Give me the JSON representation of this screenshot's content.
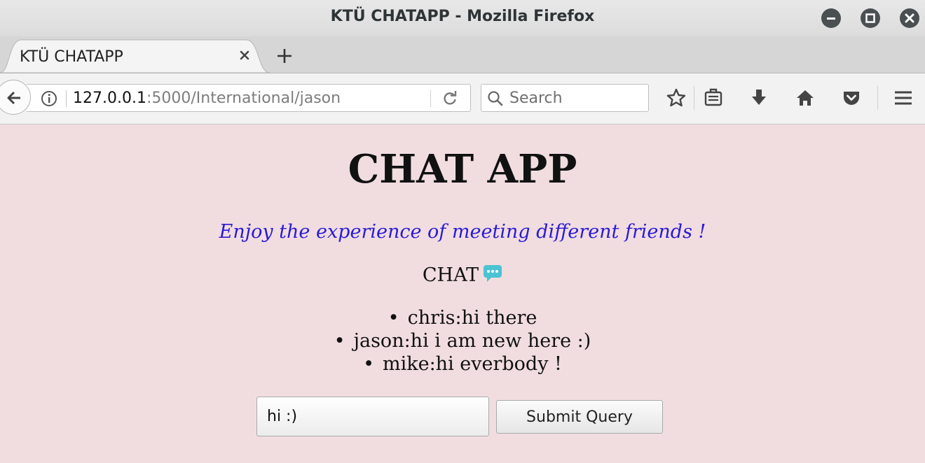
{
  "window": {
    "title": "KTÜ CHATAPP - Mozilla Firefox"
  },
  "tabs": [
    {
      "label": "KTÜ CHATAPP",
      "active": true
    }
  ],
  "navbar": {
    "url_host": "127.0.0.1",
    "url_path": ":5000/International/jason",
    "search_placeholder": "Search",
    "icons": [
      "back-icon",
      "info-icon",
      "reload-icon",
      "search-icon",
      "bookmark-star-icon",
      "reading-list-icon",
      "download-icon",
      "home-icon",
      "pocket-icon",
      "menu-icon"
    ]
  },
  "page": {
    "heading": "CHAT APP",
    "tagline": "Enjoy the experience of meeting different friends !",
    "chat_label": "CHAT",
    "messages": [
      "chris:hi there",
      "jason:hi i am new here :)",
      "mike:hi everbody !"
    ],
    "input_value": "hi :)",
    "submit_label": "Submit Query"
  },
  "colors": {
    "page_background": "#f1dde0",
    "tagline": "#2a1ad6",
    "chat_icon": "#4cc3d2"
  }
}
